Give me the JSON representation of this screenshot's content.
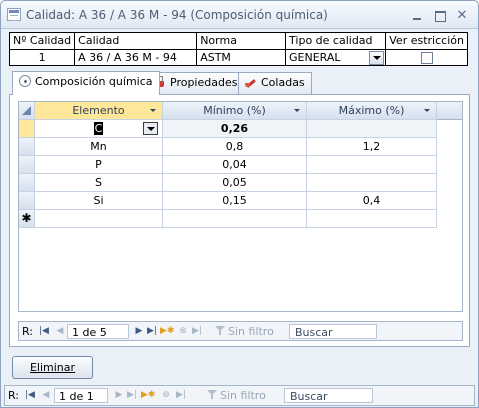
{
  "window": {
    "title": "Calidad: A 36 / A 36 M - 94 (Composición química)"
  },
  "header_table": {
    "columns": [
      "Nº Calidad",
      "Calidad",
      "Norma",
      "Tipo de calidad",
      "Ver estricción"
    ],
    "values": {
      "numero": "1",
      "calidad": "A 36 / A 36 M - 94",
      "norma": "ASTM",
      "tipo": "GENERAL",
      "ver_estriccion_checked": false
    }
  },
  "tabs": [
    {
      "label": "Composición química",
      "icon": "atom-icon",
      "active": true
    },
    {
      "label": "Propiedades",
      "icon": "flask-icon",
      "active": false
    },
    {
      "label": "Coladas",
      "icon": "ladle-icon",
      "active": false
    }
  ],
  "grid": {
    "columns": [
      "Elemento",
      "Mínimo (%)",
      "Máximo (%)"
    ],
    "rows": [
      {
        "elemento": "C",
        "minimo": "0,26",
        "maximo": ""
      },
      {
        "elemento": "Mn",
        "minimo": "0,8",
        "maximo": "1,2"
      },
      {
        "elemento": "P",
        "minimo": "0,04",
        "maximo": ""
      },
      {
        "elemento": "S",
        "minimo": "0,05",
        "maximo": ""
      },
      {
        "elemento": "Si",
        "minimo": "0,15",
        "maximo": "0,4"
      }
    ],
    "new_row_marker": "✱"
  },
  "subform_nav": {
    "record_label": "R:",
    "position": "1 de 5",
    "filter": "Sin filtro",
    "search": "Buscar"
  },
  "delete_button": {
    "label": "Eliminar"
  },
  "form_nav": {
    "record_label": "R:",
    "position": "1 de 1",
    "filter": "Sin filtro",
    "search": "Buscar"
  },
  "colors": {
    "window_bg": "#eaf0f8",
    "selected_header": "#ffe79a",
    "border": "#9aaac2"
  }
}
